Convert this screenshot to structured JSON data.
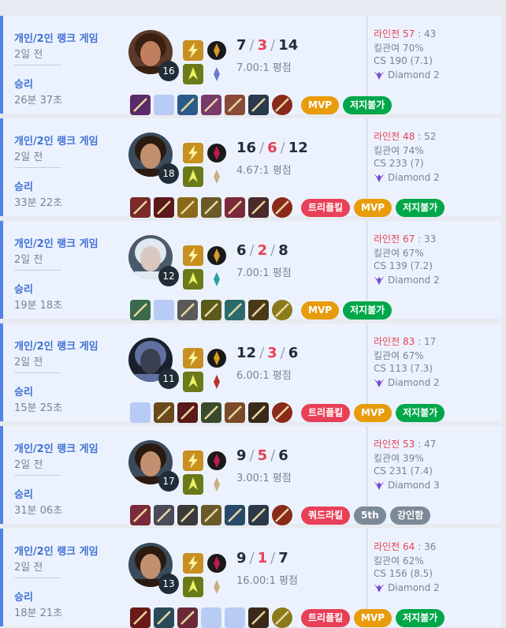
{
  "games": [
    {
      "queue": "개인/2인 랭크 게임",
      "ago": "2일 전",
      "result": "승리",
      "duration": "26분 37초",
      "level": "16",
      "kills": "7",
      "deaths": "3",
      "assists": "14",
      "ratio": "7.00:1 평점",
      "lane_label": "라인전",
      "lane_win": "57",
      "lane_sep": ":",
      "lane_lose": "43",
      "kp": "킬관여 70%",
      "cs": "CS 190 (7.1)",
      "tier": "Diamond 2",
      "champion_icon": "champion-portrait-1",
      "badges": [
        {
          "label": "MVP",
          "color": "gold"
        },
        {
          "label": "저지불가",
          "color": "green"
        }
      ],
      "items": [
        {
          "empty": false,
          "color": "#5a2a6a"
        },
        {
          "empty": true
        },
        {
          "empty": false,
          "color": "#2c5a8a"
        },
        {
          "empty": false,
          "color": "#7a3a6a"
        },
        {
          "empty": false,
          "color": "#8a4a3a"
        },
        {
          "empty": false,
          "color": "#2a3a4a"
        },
        {
          "empty": false,
          "color": "#8a2a1a",
          "ward": true
        }
      ]
    },
    {
      "queue": "개인/2인 랭크 게임",
      "ago": "2일 전",
      "result": "승리",
      "duration": "33분 22초",
      "level": "18",
      "kills": "16",
      "deaths": "6",
      "assists": "12",
      "ratio": "4.67:1 평점",
      "lane_label": "라인전",
      "lane_win": "48",
      "lane_sep": ":",
      "lane_lose": "52",
      "kp": "킬관여 74%",
      "cs": "CS 233 (7)",
      "tier": "Diamond 2",
      "champion_icon": "champion-portrait-2",
      "badges": [
        {
          "label": "트리플킬",
          "color": "red"
        },
        {
          "label": "MVP",
          "color": "gold"
        },
        {
          "label": "저지불가",
          "color": "green"
        }
      ],
      "items": [
        {
          "empty": false,
          "color": "#7a2a2a"
        },
        {
          "empty": false,
          "color": "#5a1a1a"
        },
        {
          "empty": false,
          "color": "#8a6a1a"
        },
        {
          "empty": false,
          "color": "#6a5a2a"
        },
        {
          "empty": false,
          "color": "#7a2a3a"
        },
        {
          "empty": false,
          "color": "#4a2a2a"
        },
        {
          "empty": false,
          "color": "#8a2a1a",
          "ward": true
        }
      ]
    },
    {
      "queue": "개인/2인 랭크 게임",
      "ago": "2일 전",
      "result": "승리",
      "duration": "19분 18초",
      "level": "12",
      "kills": "6",
      "deaths": "2",
      "assists": "8",
      "ratio": "7.00:1 평점",
      "lane_label": "라인전",
      "lane_win": "67",
      "lane_sep": ":",
      "lane_lose": "33",
      "kp": "킬관여 67%",
      "cs": "CS 139 (7.2)",
      "tier": "Diamond 2",
      "champion_icon": "champion-portrait-3",
      "badges": [
        {
          "label": "MVP",
          "color": "gold"
        },
        {
          "label": "저지불가",
          "color": "green"
        }
      ],
      "items": [
        {
          "empty": false,
          "color": "#3a6a4a"
        },
        {
          "empty": true
        },
        {
          "empty": false,
          "color": "#5a5a5a"
        },
        {
          "empty": false,
          "color": "#5a5a1a"
        },
        {
          "empty": false,
          "color": "#2a6a6a"
        },
        {
          "empty": false,
          "color": "#4a3a1a"
        },
        {
          "empty": false,
          "color": "#8a7a1a",
          "ward": true
        }
      ]
    },
    {
      "queue": "개인/2인 랭크 게임",
      "ago": "2일 전",
      "result": "승리",
      "duration": "15분 25초",
      "level": "11",
      "kills": "12",
      "deaths": "3",
      "assists": "6",
      "ratio": "6.00:1 평점",
      "lane_label": "라인전",
      "lane_win": "83",
      "lane_sep": ":",
      "lane_lose": "17",
      "kp": "킬관여 67%",
      "cs": "CS 113 (7.3)",
      "tier": "Diamond 2",
      "champion_icon": "champion-portrait-4",
      "badges": [
        {
          "label": "트리플킬",
          "color": "red"
        },
        {
          "label": "MVP",
          "color": "gold"
        },
        {
          "label": "저지불가",
          "color": "green"
        }
      ],
      "items": [
        {
          "empty": true
        },
        {
          "empty": false,
          "color": "#6a4a1a"
        },
        {
          "empty": false,
          "color": "#5a1a1a"
        },
        {
          "empty": false,
          "color": "#3a4a2a"
        },
        {
          "empty": false,
          "color": "#7a4a2a"
        },
        {
          "empty": false,
          "color": "#3a2a1a"
        },
        {
          "empty": false,
          "color": "#8a2a1a",
          "ward": true
        }
      ]
    },
    {
      "queue": "개인/2인 랭크 게임",
      "ago": "2일 전",
      "result": "승리",
      "duration": "31분 06초",
      "level": "17",
      "kills": "9",
      "deaths": "5",
      "assists": "6",
      "ratio": "3.00:1 평점",
      "lane_label": "라인전",
      "lane_win": "53",
      "lane_sep": ":",
      "lane_lose": "47",
      "kp": "킬관여 39%",
      "cs": "CS 231 (7.4)",
      "tier": "Diamond 3",
      "champion_icon": "champion-portrait-5",
      "badges": [
        {
          "label": "쿼드라킬",
          "color": "red"
        },
        {
          "label": "5th",
          "color": "gray"
        },
        {
          "label": "강인함",
          "color": "gray"
        }
      ],
      "items": [
        {
          "empty": false,
          "color": "#7a2a3a"
        },
        {
          "empty": false,
          "color": "#4a4a5a"
        },
        {
          "empty": false,
          "color": "#3a3a3a"
        },
        {
          "empty": false,
          "color": "#6a5a2a"
        },
        {
          "empty": false,
          "color": "#2a4a6a"
        },
        {
          "empty": false,
          "color": "#2a3a4a"
        },
        {
          "empty": false,
          "color": "#8a2a1a",
          "ward": true
        }
      ]
    },
    {
      "queue": "개인/2인 랭크 게임",
      "ago": "2일 전",
      "result": "승리",
      "duration": "18분 21초",
      "level": "13",
      "kills": "9",
      "deaths": "1",
      "assists": "7",
      "ratio": "16.00:1 평점",
      "lane_label": "라인전",
      "lane_win": "64",
      "lane_sep": ":",
      "lane_lose": "36",
      "kp": "킬관여 62%",
      "cs": "CS 156 (8.5)",
      "tier": "Diamond 2",
      "champion_icon": "champion-portrait-6",
      "badges": [
        {
          "label": "트리플킬",
          "color": "red"
        },
        {
          "label": "MVP",
          "color": "gold"
        },
        {
          "label": "저지불가",
          "color": "green"
        }
      ],
      "items": [
        {
          "empty": false,
          "color": "#6a1a1a"
        },
        {
          "empty": false,
          "color": "#2a4a5a"
        },
        {
          "empty": false,
          "color": "#6a2a3a"
        },
        {
          "empty": true
        },
        {
          "empty": true
        },
        {
          "empty": false,
          "color": "#3a2a1a"
        },
        {
          "empty": false,
          "color": "#8a7a1a",
          "ward": true
        }
      ]
    }
  ]
}
